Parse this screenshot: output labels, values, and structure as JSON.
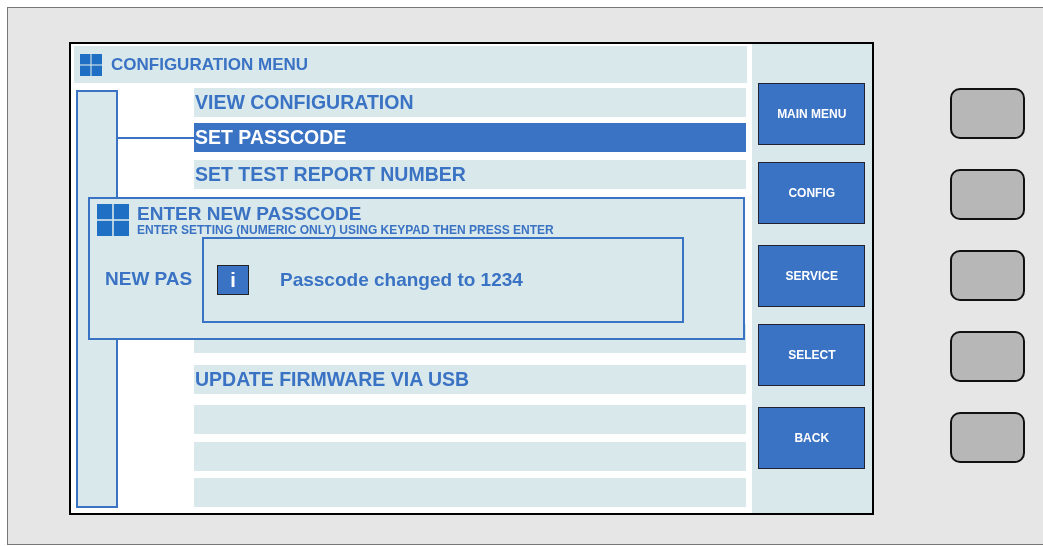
{
  "header": {
    "title": "CONFIGURATION MENU"
  },
  "menu": [
    {
      "kind": "item",
      "label": "VIEW CONFIGURATION",
      "selected": false
    },
    {
      "kind": "item",
      "label": "SET PASSCODE",
      "selected": true
    },
    {
      "kind": "item",
      "label": "SET TEST REPORT NUMBER",
      "selected": false
    },
    {
      "kind": "blank"
    },
    {
      "kind": "item",
      "label": "UPDATE FIRMWARE VIA USB",
      "selected": false
    },
    {
      "kind": "blank"
    },
    {
      "kind": "blank"
    },
    {
      "kind": "blank"
    }
  ],
  "dialog": {
    "title": "ENTER NEW PASSCODE",
    "subtitle": "ENTER SETTING (NUMERIC ONLY) USING KEYPAD THEN PRESS ENTER",
    "field_label": "NEW PAS"
  },
  "message": {
    "icon_text": "i",
    "text": "Passcode changed to 1234"
  },
  "soft_keys": [
    "MAIN MENU",
    "CONFIG",
    "SERVICE",
    "SELECT",
    "BACK"
  ]
}
